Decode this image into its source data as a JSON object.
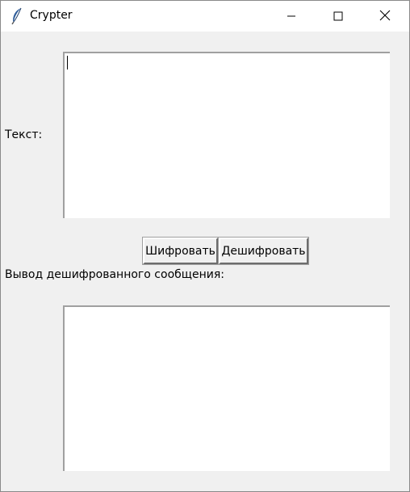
{
  "window": {
    "title": "Crypter",
    "icon": "feather-icon",
    "controls": [
      "minimize-icon",
      "maximize-icon",
      "close-icon"
    ]
  },
  "main": {
    "input_label": "Текст:",
    "input_value": "",
    "encrypt_button": "Шифровать",
    "decrypt_button": "Дешифровать",
    "output_label": "Вывод дешифрованного сообщения:",
    "output_value": ""
  },
  "colors": {
    "background": "#f0f0f0",
    "titlebar": "#ffffff",
    "textbox": "#ffffff",
    "icon_accent": "#2f5d9a"
  }
}
